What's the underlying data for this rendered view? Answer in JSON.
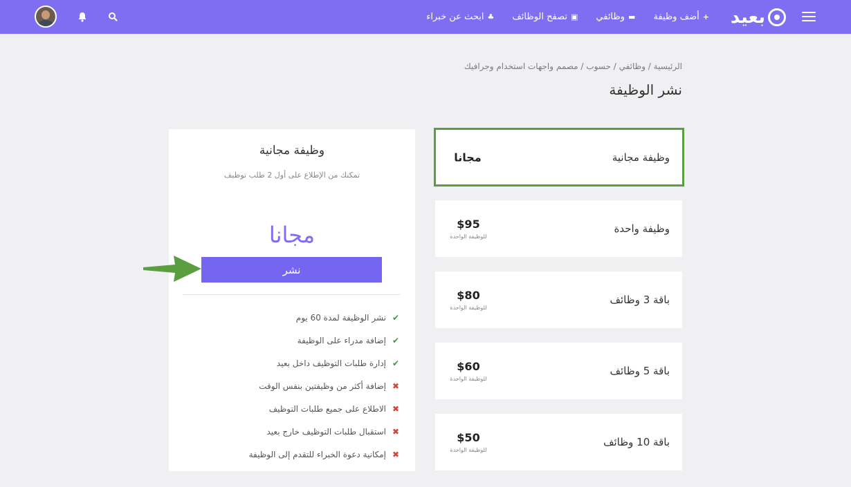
{
  "header": {
    "logo_text": "بعيد",
    "nav": [
      {
        "label": "أضف وظيفة",
        "icon": "+"
      },
      {
        "label": "وظائفي",
        "icon": "▬"
      },
      {
        "label": "تصفح الوظائف",
        "icon": "▣"
      },
      {
        "label": "ابحث عن خبراء",
        "icon": "♣"
      }
    ],
    "accent": "#7f6ef2"
  },
  "breadcrumb": "الرئيسية / وظائفي / حسوب / مصمم واجهات استخدام وجرافيك",
  "page_title": "نشر الوظيفة",
  "plans": [
    {
      "name": "وظيفة مجانية",
      "price": "مجانا",
      "unit": ""
    },
    {
      "name": "وظيفة واحدة",
      "price": "$95",
      "unit": "للوظيفة الواحدة"
    },
    {
      "name": "باقة 3 وظائف",
      "price": "$80",
      "unit": "للوظيفة الواحدة"
    },
    {
      "name": "باقة 5 وظائف",
      "price": "$60",
      "unit": "للوظيفة الواحدة"
    },
    {
      "name": "باقة 10 وظائف",
      "price": "$50",
      "unit": "للوظيفة الواحدة"
    }
  ],
  "detail": {
    "title": "وظيفة مجانية",
    "subtitle": "تمكنك من الإطلاع على أول 2 طلب توظيف",
    "price": "مجانا",
    "button_label": "نشر",
    "features": [
      {
        "text": "نشر الوظيفة لمدة 60 يوم",
        "included": true
      },
      {
        "text": "إضافة مدراء على الوظيفة",
        "included": true
      },
      {
        "text": "إدارة طلبات التوظيف داخل بعيد",
        "included": true
      },
      {
        "text": "إضافة أكثر من وظيفتين بنفس الوقت",
        "included": false
      },
      {
        "text": "الاطلاع على جميع طلبات التوظيف",
        "included": false
      },
      {
        "text": "استقبال طلبات التوظيف خارج بعيد",
        "included": false
      },
      {
        "text": "إمكانية دعوة الخبراء للتقدم إلى الوظيفة",
        "included": false
      }
    ]
  }
}
